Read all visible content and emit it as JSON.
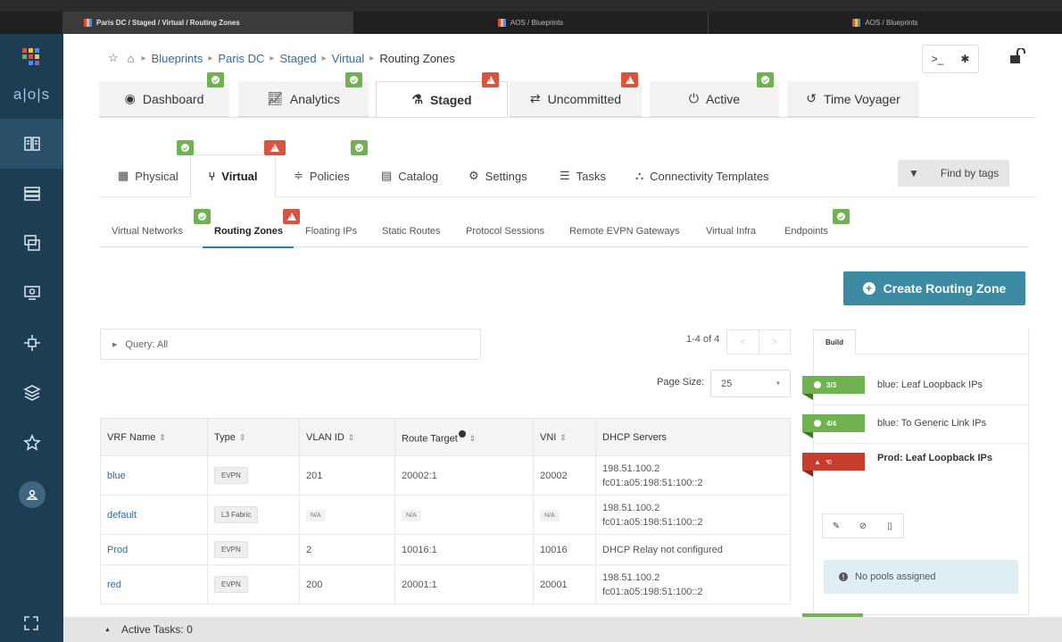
{
  "browser_tabs": [
    {
      "label": "Paris DC / Staged / Virtual / Routing Zones",
      "active": true
    },
    {
      "label": "AOS / Blueprints",
      "active": false
    },
    {
      "label": "AOS / Blueprints",
      "active": false
    }
  ],
  "sidebar": {
    "logo_text": "a|o|s",
    "items": [
      "blueprints-icon",
      "devices-icon",
      "design-icon",
      "resources-icon",
      "external-systems-icon",
      "layers-icon",
      "favorites-icon"
    ]
  },
  "breadcrumb": {
    "items": [
      "Blueprints",
      "Paris DC",
      "Staged",
      "Virtual"
    ],
    "current": "Routing Zones"
  },
  "top_tabs": [
    {
      "label": "Dashboard",
      "icon": "dashboard-icon",
      "badge": "ok"
    },
    {
      "label": "Analytics",
      "icon": "analytics-icon",
      "badge": "ok"
    },
    {
      "label": "Staged",
      "icon": "flask-icon",
      "badge": "warn",
      "active": true
    },
    {
      "label": "Uncommitted",
      "icon": "arrows-icon",
      "badge": "warn"
    },
    {
      "label": "Active",
      "icon": "power-icon",
      "badge": "ok"
    },
    {
      "label": "Time Voyager",
      "icon": "history-icon"
    }
  ],
  "sub_tabs": [
    {
      "label": "Physical",
      "badge": "ok"
    },
    {
      "label": "Virtual",
      "badge": "warn",
      "active": true
    },
    {
      "label": "Policies",
      "badge": "ok"
    },
    {
      "label": "Catalog"
    },
    {
      "label": "Settings"
    },
    {
      "label": "Tasks"
    },
    {
      "label": "Connectivity Templates"
    }
  ],
  "find_by_tags": "Find by tags",
  "third_tabs": [
    {
      "label": "Virtual Networks",
      "badge": "ok"
    },
    {
      "label": "Routing Zones",
      "badge": "warn",
      "active": true
    },
    {
      "label": "Floating IPs"
    },
    {
      "label": "Static Routes"
    },
    {
      "label": "Protocol Sessions"
    },
    {
      "label": "Remote EVPN Gateways"
    },
    {
      "label": "Virtual Infra"
    },
    {
      "label": "Endpoints",
      "badge": "ok"
    }
  ],
  "create_button": "Create Routing Zone",
  "query": "Query: All",
  "pager": {
    "range": "1-4 of 4",
    "page_size_label": "Page Size:",
    "page_size": "25"
  },
  "table": {
    "columns": [
      "VRF Name",
      "Type",
      "VLAN ID",
      "Route Target",
      "VNI",
      "DHCP Servers"
    ],
    "rows": [
      {
        "name": "blue",
        "type": "EVPN",
        "vlan": "201",
        "rt": "20002:1",
        "vni": "20002",
        "dhcp1": "198.51.100.2",
        "dhcp2": "fc01:a05:198:51:100::2"
      },
      {
        "name": "default",
        "type": "L3 Fabric",
        "vlan": "N/A",
        "rt": "N/A",
        "vni": "N/A",
        "dhcp1": "198.51.100.2",
        "dhcp2": "fc01:a05:198:51:100::2"
      },
      {
        "name": "Prod",
        "type": "EVPN",
        "vlan": "2",
        "rt": "10016:1",
        "vni": "10016",
        "dhcp1": "DHCP Relay not configured",
        "dhcp2": ""
      },
      {
        "name": "red",
        "type": "EVPN",
        "vlan": "200",
        "rt": "20001:1",
        "vni": "20001",
        "dhcp1": "198.51.100.2",
        "dhcp2": "fc01:a05:198:51:100::2"
      }
    ]
  },
  "build_panel": {
    "tab": "Build",
    "items": [
      {
        "status": "ok",
        "count": "3/3",
        "label": "blue: Leaf Loopback IPs"
      },
      {
        "status": "ok",
        "count": "4/4",
        "label": "blue: To Generic Link IPs"
      },
      {
        "status": "warn",
        "count": "",
        "label": "Prod: Leaf Loopback IPs"
      }
    ],
    "no_pools": "No pools assigned"
  },
  "bottom_bar": "Active Tasks: 0",
  "colors": {
    "accent": "#3d8ba3",
    "ok": "#6fb24f",
    "warn": "#d9533f",
    "nav": "#1d3d52"
  }
}
